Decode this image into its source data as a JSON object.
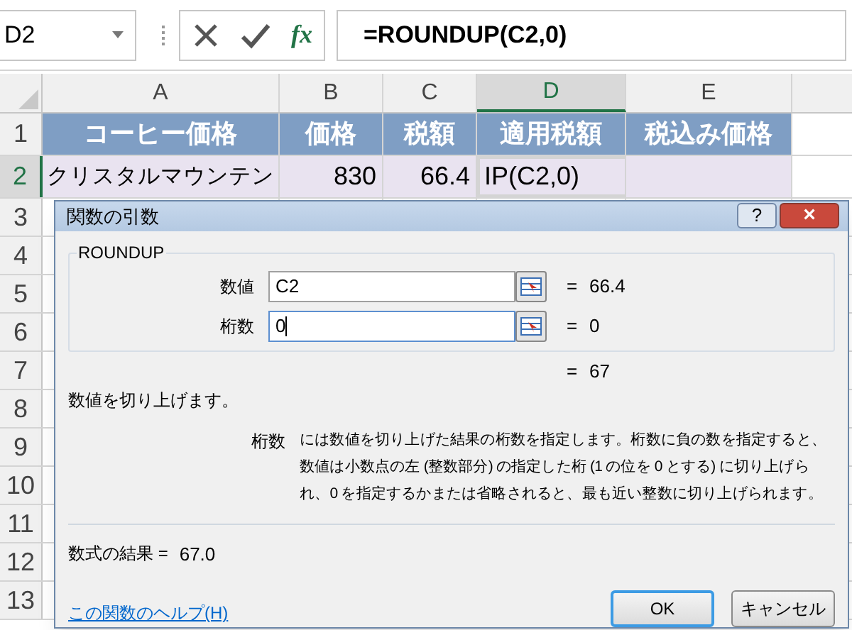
{
  "name_box": "D2",
  "formula": "=ROUNDUP(C2,0)",
  "formula_buttons": [
    {
      "kind": "cancel"
    },
    {
      "kind": "enter"
    },
    {
      "kind": "fx",
      "label": "fx"
    }
  ],
  "columns": [
    {
      "label": "A",
      "selected": false
    },
    {
      "label": "B",
      "selected": false
    },
    {
      "label": "C",
      "selected": false
    },
    {
      "label": "D",
      "selected": true
    },
    {
      "label": "E",
      "selected": false
    }
  ],
  "rows": [
    {
      "label": "1",
      "selected": false,
      "kind": "header",
      "cells": [
        "コーヒー価格",
        "価格",
        "税額",
        "適用税額",
        "税込み価格"
      ]
    },
    {
      "label": "2",
      "selected": true,
      "kind": "data",
      "cells": [
        "クリスタルマウンテン",
        "830",
        "66.4",
        "IP(C2,0)",
        ""
      ]
    },
    {
      "label": "3",
      "selected": false,
      "kind": "blank",
      "cells": []
    },
    {
      "label": "4",
      "selected": false,
      "kind": "blank",
      "cells": []
    },
    {
      "label": "5",
      "selected": false,
      "kind": "blank",
      "cells": []
    },
    {
      "label": "6",
      "selected": false,
      "kind": "blank",
      "cells": []
    },
    {
      "label": "7",
      "selected": false,
      "kind": "blank",
      "cells": []
    },
    {
      "label": "8",
      "selected": false,
      "kind": "blank",
      "cells": []
    },
    {
      "label": "9",
      "selected": false,
      "kind": "blank",
      "cells": []
    },
    {
      "label": "10",
      "selected": false,
      "kind": "blank",
      "cells": []
    },
    {
      "label": "11",
      "selected": false,
      "kind": "blank",
      "cells": []
    },
    {
      "label": "12",
      "selected": false,
      "kind": "blank",
      "cells": []
    },
    {
      "label": "13",
      "selected": false,
      "kind": "blank",
      "cells": []
    }
  ],
  "dialog": {
    "title": "関数の引数",
    "help_button": "?",
    "close_button": "×",
    "function_name": "ROUNDUP",
    "arguments": [
      {
        "label": "数値",
        "value": "C2",
        "equals": "=",
        "result": "66.4",
        "focused": false
      },
      {
        "label": "桁数",
        "value": "0",
        "equals": "=",
        "result": "0",
        "focused": true
      }
    ],
    "result_equals": "=",
    "result": "67",
    "description": "数値を切り上げます。",
    "arg_help_label": "桁数",
    "arg_help_text": "には数値を切り上げた結果の桁数を指定します。桁数に負の数を指定すると、数値は小数点の左 (整数部分) の指定した桁 (1 の位を 0 とする) に切り上げられ、0 を指定するかまたは省略されると、最も近い整数に切り上げられます。",
    "formula_result_label": "数式の結果 =",
    "formula_result": "67.0",
    "help_link": "この関数のヘルプ(H)",
    "buttons": [
      "OK",
      "キャンセル"
    ]
  }
}
